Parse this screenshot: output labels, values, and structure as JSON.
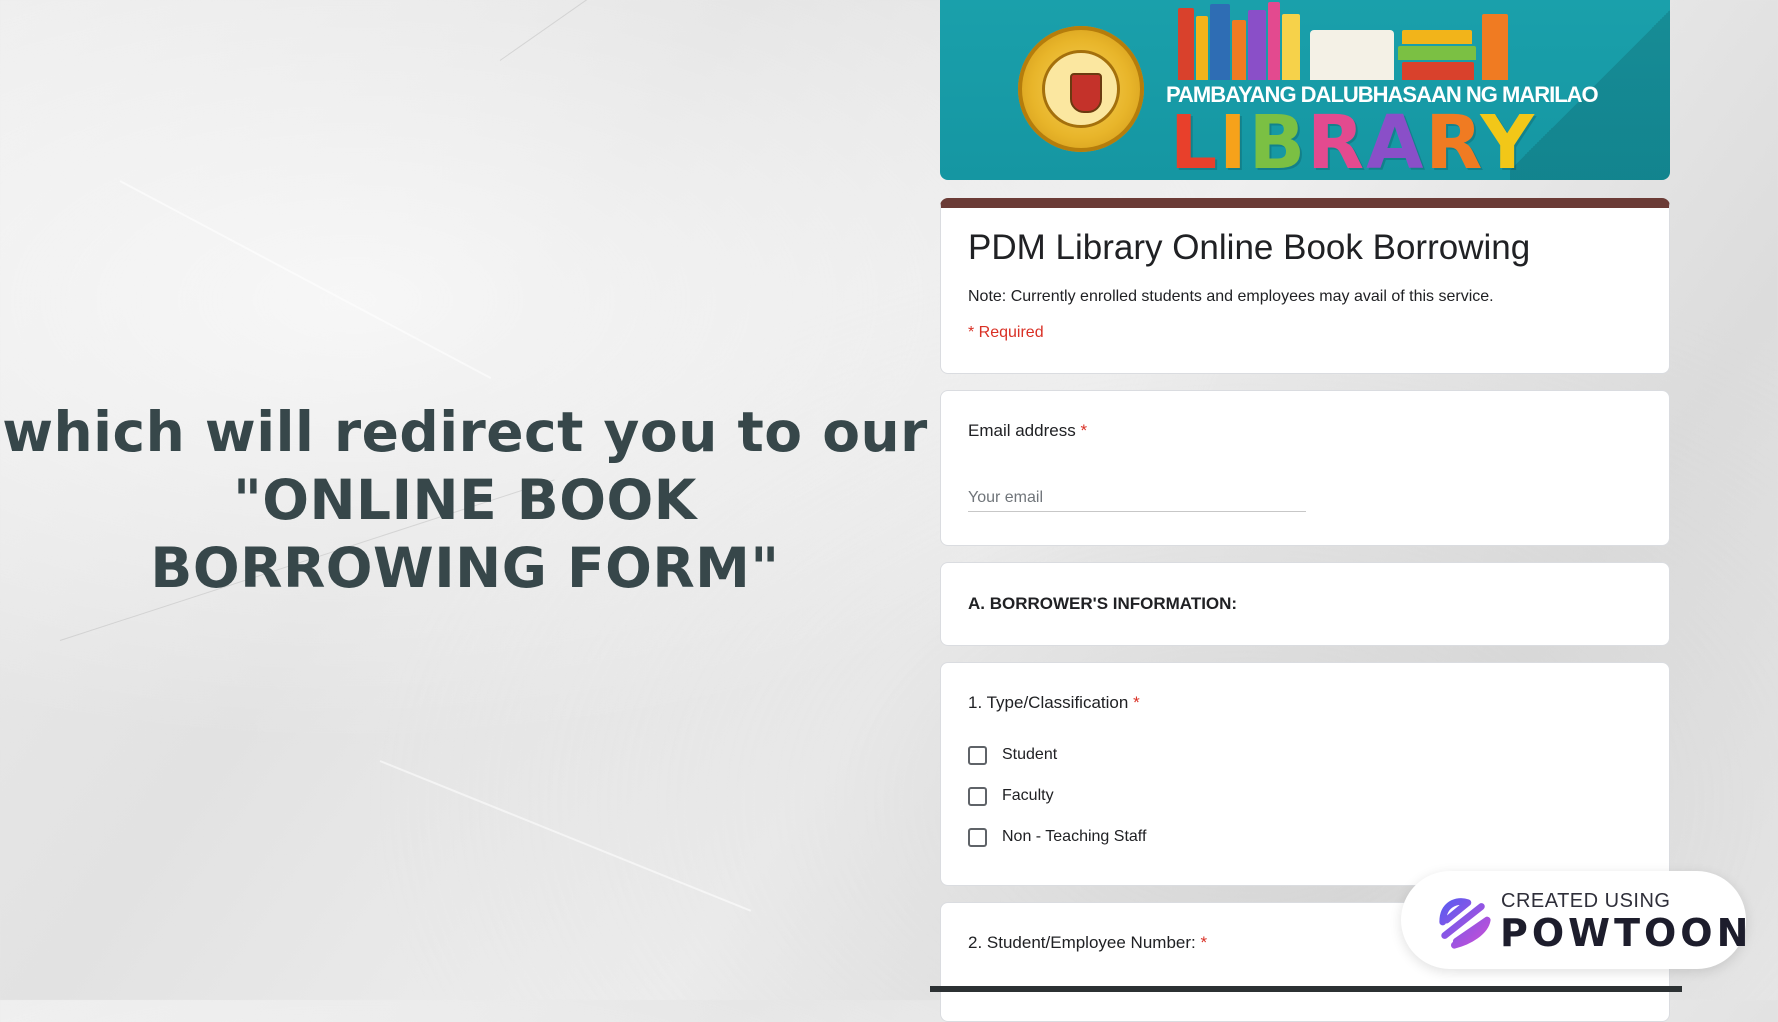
{
  "slide": {
    "headline_line1": "which will redirect you to our",
    "headline_line2": "\"ONLINE BOOK",
    "headline_line3": "BORROWING FORM\""
  },
  "banner": {
    "subtitle": "PAMBAYANG DALUBHASAAN NG MARILAO",
    "title_letters": [
      {
        "ch": "L",
        "color": "#e8402b"
      },
      {
        "ch": "I",
        "color": "#f6a21a"
      },
      {
        "ch": "B",
        "color": "#7bc043"
      },
      {
        "ch": "R",
        "color": "#e34a8f"
      },
      {
        "ch": "A",
        "color": "#8a4fc8"
      },
      {
        "ch": "R",
        "color": "#f07b22"
      },
      {
        "ch": "Y",
        "color": "#f2c718"
      }
    ]
  },
  "form": {
    "title": "PDM Library Online Book Borrowing",
    "note": "Note: Currently enrolled students and employees may avail of this service.",
    "required_label": "* Required",
    "accent_color": "#6b3b36",
    "email": {
      "label": "Email address",
      "required_mark": "*",
      "placeholder": "Your email"
    },
    "section_title": "A. BORROWER'S INFORMATION:",
    "q1": {
      "label": "1. Type/Classification",
      "required_mark": "*",
      "options": [
        "Student",
        "Faculty",
        "Non - Teaching Staff"
      ]
    },
    "q2": {
      "label": "2. Student/Employee Number:",
      "required_mark": "*"
    }
  },
  "watermark": {
    "line1": "CREATED USING",
    "line2": "POWTOON",
    "icon": "powtoon-logo-icon"
  }
}
